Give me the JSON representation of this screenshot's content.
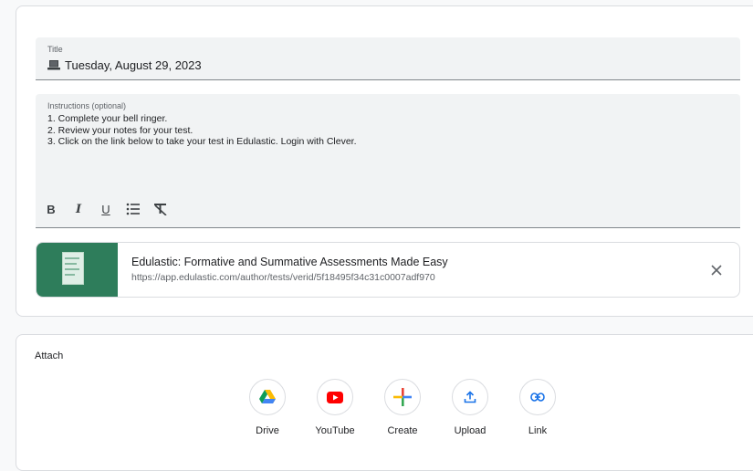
{
  "title_field": {
    "label": "Title",
    "value": "Tuesday, August 29, 2023"
  },
  "instructions_field": {
    "label": "Instructions (optional)",
    "lines": [
      "1.  Complete your bell ringer.",
      "2.  Review your notes for your test.",
      "3.  Click on the link below to take your test in Edulastic.  Login with Clever."
    ]
  },
  "toolbar": {
    "bold": "B",
    "italic": "I",
    "underline": "U"
  },
  "link_attachment": {
    "title": "Edulastic: Formative and Summative Assessments Made Easy",
    "url": "https://app.edulastic.com/author/tests/verid/5f18495f34c31c0007adf970"
  },
  "attach": {
    "label": "Attach",
    "items": [
      {
        "label": "Drive",
        "icon": "google-drive-icon"
      },
      {
        "label": "YouTube",
        "icon": "youtube-icon"
      },
      {
        "label": "Create",
        "icon": "create-plus-icon"
      },
      {
        "label": "Upload",
        "icon": "upload-icon"
      },
      {
        "label": "Link",
        "icon": "link-icon"
      }
    ]
  },
  "colors": {
    "youtube_red": "#ff0000",
    "field_bg": "#f1f3f4",
    "thumb_green": "#2e7d5b",
    "link_blue": "#1a73e8"
  }
}
